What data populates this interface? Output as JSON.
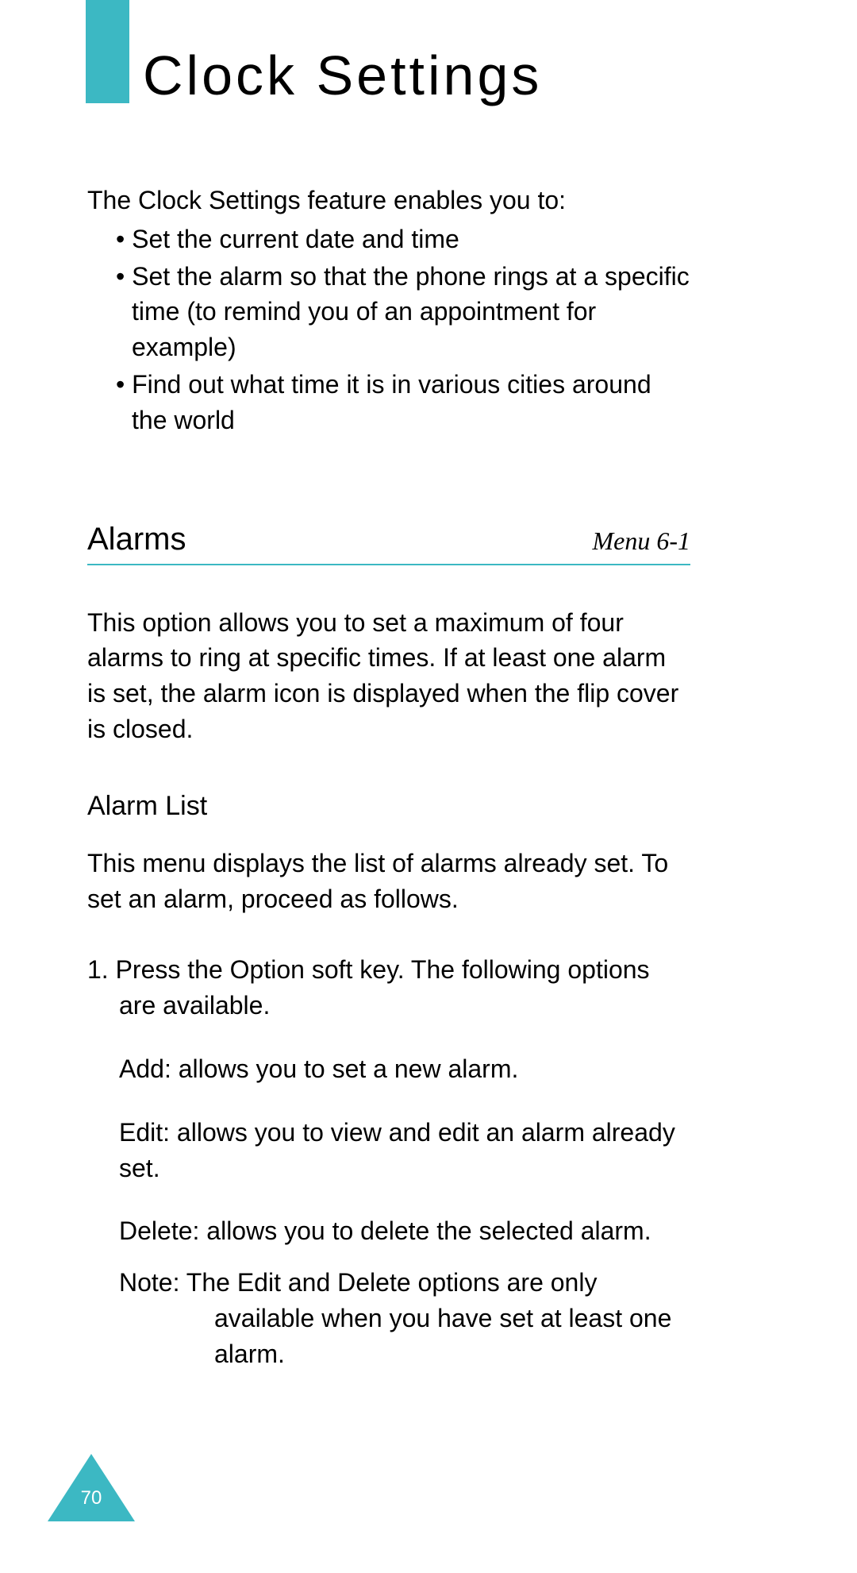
{
  "page_title": "Clock Settings",
  "intro": "The Clock Settings feature enables you to:",
  "bullets": [
    "Set the current date and time",
    "Set the alarm so that the phone rings at a specific time (to remind you of an appointment for example)",
    "Find out what time it is in various cities around the world"
  ],
  "section": {
    "title": "Alarms",
    "menu_ref": "Menu 6-1",
    "description": "This option allows you to set a maximum of four alarms to ring at specific times. If at least one alarm is set, the alarm icon is displayed when the flip cover is closed."
  },
  "subsection": {
    "title": "Alarm List",
    "description": "This menu displays the list of alarms already set. To set an alarm, proceed as follows.",
    "step1_prefix": "1.  Press the ",
    "step1_key": "Option",
    "step1_suffix": " soft key. The following options are available.",
    "options": [
      {
        "key": "Add:",
        "text": " allows you to set a new alarm."
      },
      {
        "key": "Edit:",
        "text": " allows you to view and edit an alarm already set."
      },
      {
        "key": "Delete:",
        "text": " allows you to delete the selected alarm."
      }
    ],
    "note_label": "Note: ",
    "note_text": "The Edit and Delete options are only available when you have set at least one alarm."
  },
  "page_number": "70"
}
